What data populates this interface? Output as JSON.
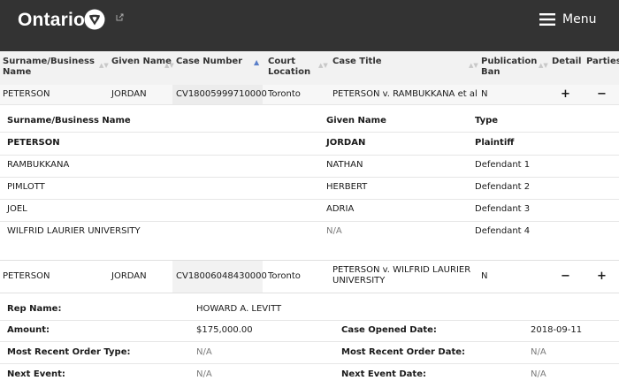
{
  "header": {
    "logo_text": "Ontario",
    "menu_label": "Menu"
  },
  "columns": {
    "surname": "Surname/Business Name",
    "given": "Given Name",
    "case_number": "Case Number",
    "court_location": "Court Location",
    "case_title": "Case Title",
    "publication_ban": "Publication Ban",
    "detail": "Detail",
    "parties": "Parties"
  },
  "case1": {
    "surname": "PETERSON",
    "given": "JORDAN",
    "case_number": "CV18005999710000",
    "court_location": "Toronto",
    "case_title": "PETERSON v. RAMBUKKANA et al",
    "publication_ban": "N",
    "detail_toggle": "+",
    "parties_toggle": "−"
  },
  "parties_table": {
    "headers": {
      "name": "Surname/Business Name",
      "given": "Given Name",
      "type": "Type"
    },
    "rows": [
      {
        "name": "PETERSON",
        "given": "JORDAN",
        "type": "Plaintiff"
      },
      {
        "name": "RAMBUKKANA",
        "given": "NATHAN",
        "type": "Defendant 1"
      },
      {
        "name": "PIMLOTT",
        "given": "HERBERT",
        "type": "Defendant 2"
      },
      {
        "name": "JOEL",
        "given": "ADRIA",
        "type": "Defendant 3"
      },
      {
        "name": "WILFRID LAURIER UNIVERSITY",
        "given": "N/A",
        "type": "Defendant 4"
      }
    ]
  },
  "case2": {
    "surname": "PETERSON",
    "given": "JORDAN",
    "case_number": "CV18006048430000",
    "court_location": "Toronto",
    "case_title": "PETERSON v. WILFRID LAURIER UNIVERSITY",
    "publication_ban": "N",
    "detail_toggle": "−",
    "parties_toggle": "+"
  },
  "details": {
    "rep_name_label": "Rep Name:",
    "rep_name": "HOWARD A. LEVITT",
    "amount_label": "Amount:",
    "amount": "$175,000.00",
    "case_opened_label": "Case Opened Date:",
    "case_opened": "2018-09-11",
    "recent_order_type_label": "Most Recent Order Type:",
    "recent_order_type": "N/A",
    "recent_order_date_label": "Most Recent Order Date:",
    "recent_order_date": "N/A",
    "next_event_label": "Next Event:",
    "next_event": "N/A",
    "next_event_date_label": "Next Event Date:",
    "next_event_date": "N/A"
  }
}
